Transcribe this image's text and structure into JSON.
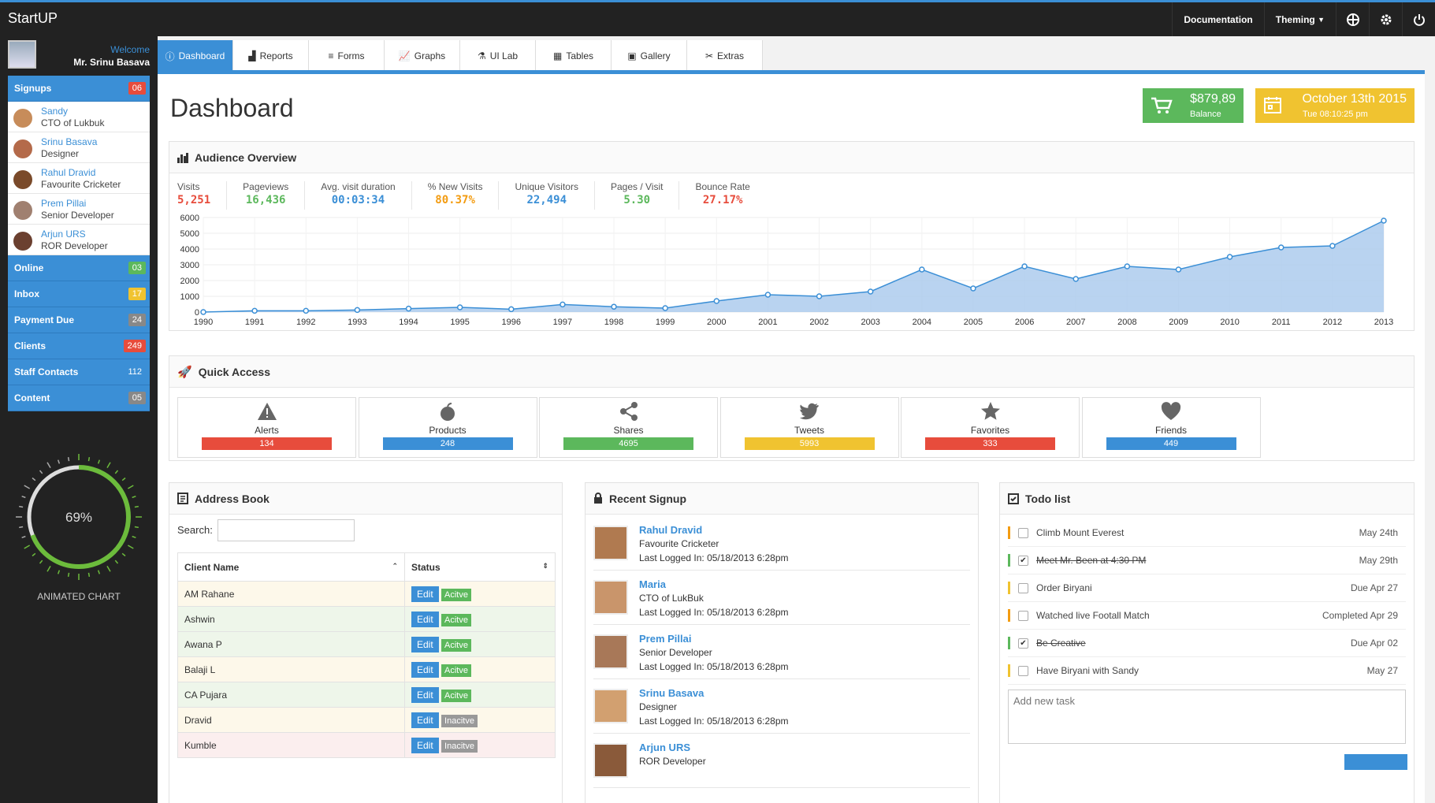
{
  "app": {
    "brand": "StartUP"
  },
  "topnav": {
    "documentation": "Documentation",
    "theming": "Theming",
    "icons": [
      "globe-icon",
      "gear-icon",
      "power-icon"
    ]
  },
  "sidebar": {
    "welcome": "Welcome",
    "user": "Mr. Srinu Basava",
    "signups": {
      "label": "Signups",
      "count": "06"
    },
    "people": [
      {
        "name": "Sandy",
        "role": "CTO of Lukbuk"
      },
      {
        "name": "Srinu Basava",
        "role": "Designer"
      },
      {
        "name": "Rahul Dravid",
        "role": "Favourite Cricketer"
      },
      {
        "name": "Prem Pillai",
        "role": "Senior Developer"
      },
      {
        "name": "Arjun URS",
        "role": "ROR Developer"
      }
    ],
    "items": [
      {
        "label": "Online",
        "count": "03",
        "color": "#5cb85c"
      },
      {
        "label": "Inbox",
        "count": "17",
        "color": "#f0c330"
      },
      {
        "label": "Payment Due",
        "count": "24",
        "color": "#888888"
      },
      {
        "label": "Clients",
        "count": "249",
        "color": "#e74c3c"
      },
      {
        "label": "Staff Contacts",
        "count": "112",
        "color": "#3b8fd6"
      },
      {
        "label": "Content",
        "count": "05",
        "color": "#888888"
      }
    ],
    "gauge": {
      "value": "69%",
      "percent": 69,
      "label": "ANIMATED CHART"
    }
  },
  "tabs": [
    "Dashboard",
    "Reports",
    "Forms",
    "Graphs",
    "UI Lab",
    "Tables",
    "Gallery",
    "Extras"
  ],
  "dashboard": {
    "title": "Dashboard",
    "balance": {
      "value": "$879,89",
      "label": "Balance"
    },
    "date": {
      "value": "October 13th 2015",
      "time": "Tue 08:10:25 pm"
    }
  },
  "audience": {
    "title": "Audience Overview",
    "metrics": [
      {
        "label": "Visits",
        "value": "5,251",
        "color": "#e74c3c"
      },
      {
        "label": "Pageviews",
        "value": "16,436",
        "color": "#5cb85c"
      },
      {
        "label": "Avg. visit duration",
        "value": "00:03:34",
        "color": "#3b8fd6"
      },
      {
        "label": "% New Visits",
        "value": "80.37%",
        "color": "#f39c12"
      },
      {
        "label": "Unique Visitors",
        "value": "22,494",
        "color": "#3b8fd6"
      },
      {
        "label": "Pages / Visit",
        "value": "5.30",
        "color": "#5cb85c"
      },
      {
        "label": "Bounce Rate",
        "value": "27.17%",
        "color": "#e74c3c"
      }
    ]
  },
  "chart_data": {
    "type": "area",
    "x": [
      1990,
      1991,
      1992,
      1993,
      1994,
      1995,
      1996,
      1997,
      1998,
      1999,
      2000,
      2001,
      2002,
      2003,
      2004,
      2005,
      2006,
      2007,
      2008,
      2009,
      2010,
      2011,
      2012,
      2013
    ],
    "values": [
      0,
      80,
      80,
      130,
      220,
      300,
      180,
      480,
      340,
      250,
      700,
      1100,
      1000,
      1300,
      2700,
      1500,
      2900,
      2100,
      2900,
      2700,
      3500,
      4100,
      4200,
      5800
    ],
    "yticks": [
      0,
      1000,
      2000,
      3000,
      4000,
      5000,
      6000
    ],
    "ylim": [
      0,
      6000
    ],
    "xlabel": "",
    "ylabel": "",
    "grid": true,
    "color": "#3b8fd6"
  },
  "quick_access": {
    "title": "Quick Access",
    "items": [
      {
        "label": "Alerts",
        "count": "134",
        "color": "#e74c3c",
        "icon": "warning-icon"
      },
      {
        "label": "Products",
        "count": "248",
        "color": "#3b8fd6",
        "icon": "apple-icon"
      },
      {
        "label": "Shares",
        "count": "4695",
        "color": "#5cb85c",
        "icon": "share-icon"
      },
      {
        "label": "Tweets",
        "count": "5993",
        "color": "#f0c330",
        "icon": "twitter-icon"
      },
      {
        "label": "Favorites",
        "count": "333",
        "color": "#e74c3c",
        "icon": "star-icon"
      },
      {
        "label": "Friends",
        "count": "449",
        "color": "#3b8fd6",
        "icon": "heart-icon"
      }
    ]
  },
  "address_book": {
    "title": "Address Book",
    "search_label": "Search:",
    "columns": [
      "Client Name",
      "Status"
    ],
    "edit_label": "Edit",
    "rows": [
      {
        "name": "AM Rahane",
        "status": "Acitve",
        "bg": "#fdf8ea"
      },
      {
        "name": "Ashwin",
        "status": "Acitve",
        "bg": "#eef6ea"
      },
      {
        "name": "Awana P",
        "status": "Acitve",
        "bg": "#eef6ea"
      },
      {
        "name": "Balaji L",
        "status": "Acitve",
        "bg": "#fdf8ea"
      },
      {
        "name": "CA Pujara",
        "status": "Acitve",
        "bg": "#eef6ea"
      },
      {
        "name": "Dravid",
        "status": "Inacitve",
        "bg": "#fdf8ea"
      },
      {
        "name": "Kumble",
        "status": "Inacitve",
        "bg": "#fbeeee"
      }
    ]
  },
  "recent_signups": {
    "title": "Recent Signup",
    "items": [
      {
        "name": "Rahul Dravid",
        "role": "Favourite Cricketer",
        "last": "Last Logged In: 05/18/2013 6:28pm"
      },
      {
        "name": "Maria",
        "role": "CTO of LukBuk",
        "last": "Last Logged In: 05/18/2013 6:28pm"
      },
      {
        "name": "Prem Pillai",
        "role": "Senior Developer",
        "last": "Last Logged In: 05/18/2013 6:28pm"
      },
      {
        "name": "Srinu Basava",
        "role": "Designer",
        "last": "Last Logged In: 05/18/2013 6:28pm"
      },
      {
        "name": "Arjun URS",
        "role": "ROR Developer",
        "last": ""
      }
    ]
  },
  "todo": {
    "title": "Todo list",
    "placeholder": "Add new task",
    "items": [
      {
        "text": "Climb Mount Everest",
        "date": "May 24th",
        "done": false,
        "color": "#f39c12"
      },
      {
        "text": "Meet Mr. Been at 4:30 PM",
        "date": "May 29th",
        "done": true,
        "color": "#5cb85c"
      },
      {
        "text": "Order Biryani",
        "date": "Due Apr 27",
        "done": false,
        "color": "#f0c330"
      },
      {
        "text": "Watched live Footall Match",
        "date": "Completed Apr 29",
        "done": false,
        "color": "#f39c12"
      },
      {
        "text": "Be Creative",
        "date": "Due Apr 02",
        "done": true,
        "color": "#5cb85c"
      },
      {
        "text": "Have Biryani with Sandy",
        "date": "May 27",
        "done": false,
        "color": "#f0c330"
      }
    ]
  }
}
